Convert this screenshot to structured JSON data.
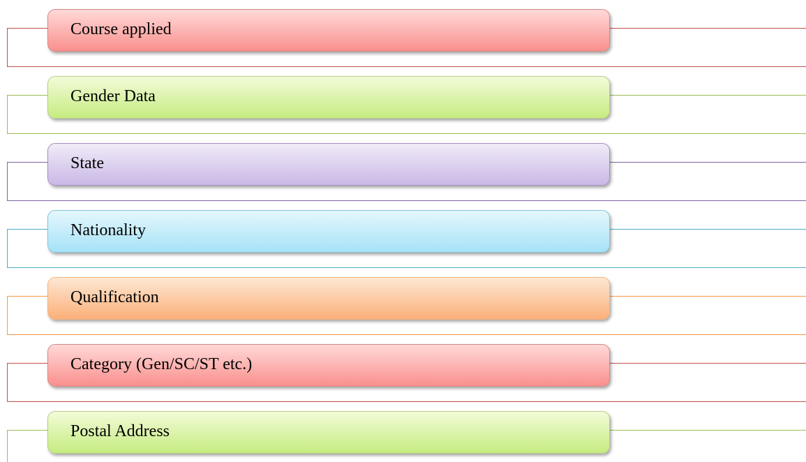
{
  "diagram": {
    "items": [
      {
        "label": "Course applied",
        "color": "#c0504d",
        "border": "#d48a88",
        "fill_top": "#ffd9d8",
        "fill_bottom": "#f9908d"
      },
      {
        "label": "Gender Data",
        "color": "#9bbb59",
        "border": "#b9cf86",
        "fill_top": "#f2fbd9",
        "fill_bottom": "#c6ec80"
      },
      {
        "label": "State",
        "color": "#8064a2",
        "border": "#a791c0",
        "fill_top": "#f1ebf8",
        "fill_bottom": "#c9b8e6"
      },
      {
        "label": "Nationality",
        "color": "#4bacc6",
        "border": "#85c6d8",
        "fill_top": "#e5f7fd",
        "fill_bottom": "#a6e2f7"
      },
      {
        "label": "Qualification",
        "color": "#f79646",
        "border": "#f8b47a",
        "fill_top": "#fde7d3",
        "fill_bottom": "#fbb07a"
      },
      {
        "label": "Category (Gen/SC/ST etc.)",
        "color": "#c0504d",
        "border": "#d48a88",
        "fill_top": "#ffd9d8",
        "fill_bottom": "#f9908d"
      },
      {
        "label": "Postal Address",
        "color": "#9bbb59",
        "border": "#b9cf86",
        "fill_top": "#f2fbd9",
        "fill_bottom": "#c6ec80"
      }
    ]
  }
}
